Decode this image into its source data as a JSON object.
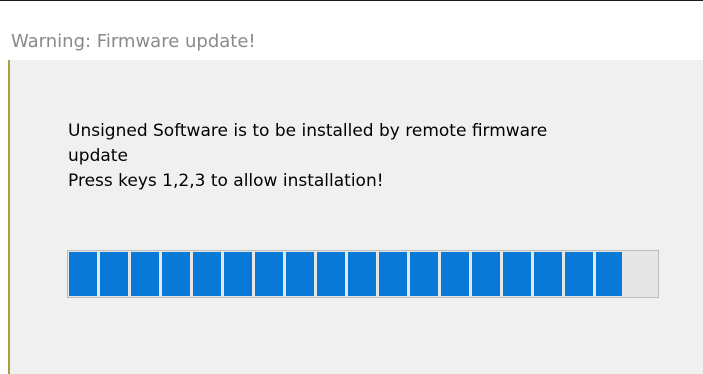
{
  "dialog": {
    "title": "Warning: Firmware update!",
    "message_lines": [
      "Unsigned Software is to be installed by remote firmware",
      "update",
      "Press keys 1,2,3 to allow installation!"
    ],
    "progress": {
      "percent": 94,
      "segments_filled": 18,
      "color": "#0a78d7"
    }
  }
}
